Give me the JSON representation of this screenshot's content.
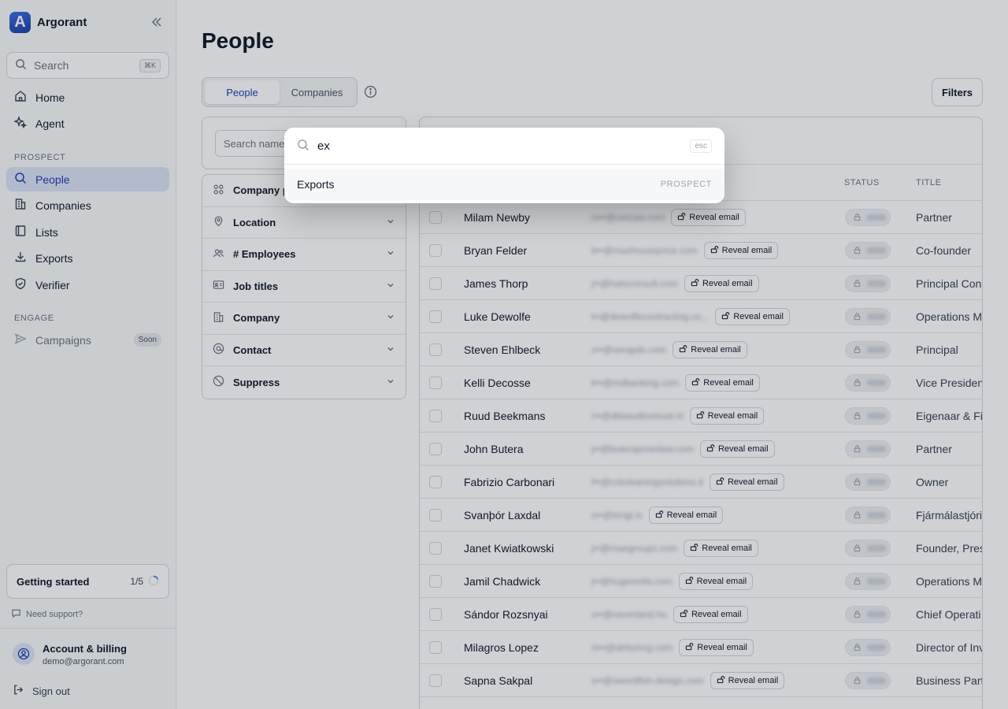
{
  "brand": {
    "name": "Argorant",
    "logo_letter": "A"
  },
  "sidebar": {
    "search_label": "Search",
    "search_shortcut": "⌘K",
    "nav_top": [
      {
        "label": "Home",
        "icon": "home-icon"
      },
      {
        "label": "Agent",
        "icon": "sparkle-icon"
      }
    ],
    "section_prospect": "PROSPECT",
    "nav_prospect": [
      {
        "label": "People",
        "icon": "search-icon",
        "active": true
      },
      {
        "label": "Companies",
        "icon": "building-icon"
      },
      {
        "label": "Lists",
        "icon": "list-icon"
      },
      {
        "label": "Exports",
        "icon": "download-icon"
      },
      {
        "label": "Verifier",
        "icon": "shield-check-icon"
      }
    ],
    "section_engage": "ENGAGE",
    "nav_engage": [
      {
        "label": "Campaigns",
        "icon": "send-icon",
        "badge": "Soon"
      }
    ],
    "getting_started": {
      "label": "Getting started",
      "progress": "1/5",
      "progress_fraction": 0.2
    },
    "support_label": "Need support?",
    "account": {
      "title": "Account & billing",
      "email": "demo@argorant.com"
    },
    "signout_label": "Sign out"
  },
  "main": {
    "title": "People",
    "tabs": [
      {
        "label": "People",
        "active": true
      },
      {
        "label": "Companies"
      }
    ],
    "filters_label": "Filters",
    "filter_search_placeholder": "Search name",
    "filters": [
      {
        "label": "Company p",
        "icon": "grid-icon"
      },
      {
        "label": "Location",
        "icon": "pin-icon"
      },
      {
        "label": "# Employees",
        "icon": "users-icon"
      },
      {
        "label": "Job titles",
        "icon": "id-card-icon"
      },
      {
        "label": "Company",
        "icon": "building-icon"
      },
      {
        "label": "Contact",
        "icon": "at-icon"
      },
      {
        "label": "Suppress",
        "icon": "ban-icon"
      }
    ],
    "table": {
      "columns": {
        "status": "STATUS",
        "title": "TITLE"
      },
      "reveal_label": "Reveal email",
      "rows": [
        {
          "name": "Milam Newby",
          "email": "m••@oelzaw.com",
          "title": "Partner"
        },
        {
          "name": "Bryan Felder",
          "email": "b••@maxhouseprice.com",
          "title": "Co-founder"
        },
        {
          "name": "James Thorp",
          "email": "j••@hatsconsult.com",
          "title": "Principal Con"
        },
        {
          "name": "Luke Dewolfe",
          "email": "l••@dewolfecontracting.co...",
          "title": "Operations M"
        },
        {
          "name": "Steven Ehlbeck",
          "email": "s••@serapds.com",
          "title": "Principal"
        },
        {
          "name": "Kelli Decosse",
          "email": "k••@mdbanking.com",
          "title": "Vice Presiden"
        },
        {
          "name": "Ruud Beekmans",
          "email": "r••@dkbaudiovisual.nl",
          "title": "Eigenaar & Fi"
        },
        {
          "name": "John Butera",
          "email": "j••@buterapmeslaw.com",
          "title": "Partner"
        },
        {
          "name": "Fabrizio Carbonari",
          "email": "f••@crbcleaningsolutions.it",
          "title": "Owner"
        },
        {
          "name": "Svanþór Laxdal",
          "email": "s••@tengi.is",
          "title": "Fjármálastjóri"
        },
        {
          "name": "Janet Kwiatkowski",
          "email": "j••@maegroups.com",
          "title": "Founder, Pres"
        },
        {
          "name": "Jamil Chadwick",
          "email": "j••@hugenmfa.com",
          "title": "Operations M"
        },
        {
          "name": "Sándor Rozsnyai",
          "email": "s••@neverland.hu",
          "title": "Chief Operati"
        },
        {
          "name": "Milagros Lopez",
          "email": "m••@atrtumcg.com",
          "title": "Director of Inv"
        },
        {
          "name": "Sapna Sakpal",
          "email": "s••@swordfish-design.com",
          "title": "Business Part"
        }
      ]
    }
  },
  "palette": {
    "query": "ex",
    "esc_label": "esc",
    "result": {
      "label": "Exports",
      "section": "PROSPECT"
    }
  }
}
